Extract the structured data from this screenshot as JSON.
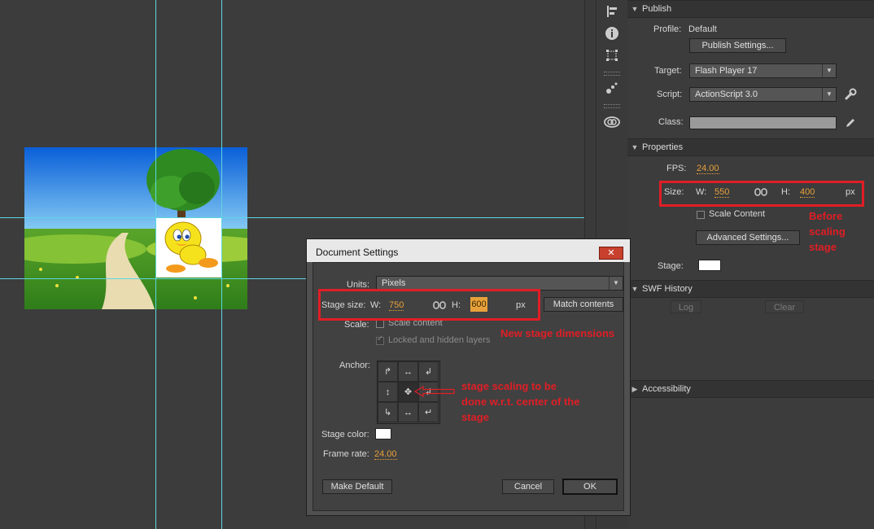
{
  "publish": {
    "header": "Publish",
    "profile_label": "Profile:",
    "profile_value": "Default",
    "publish_settings_button": "Publish Settings...",
    "target_label": "Target:",
    "target_value": "Flash Player 17",
    "script_label": "Script:",
    "script_value": "ActionScript 3.0",
    "class_label": "Class:"
  },
  "properties": {
    "header": "Properties",
    "fps_label": "FPS:",
    "fps_value": "24.00",
    "size_label": "Size:",
    "w_label": "W:",
    "w_value": "550",
    "h_label": "H:",
    "h_value": "400",
    "unit": "px",
    "scale_content_label": "Scale Content",
    "advanced_settings_button": "Advanced Settings...",
    "stage_label": "Stage:",
    "stage_color": "#ffffff"
  },
  "swf_history": {
    "header": "SWF History",
    "log_button": "Log",
    "clear_button": "Clear"
  },
  "accessibility": {
    "header": "Accessibility"
  },
  "dialog": {
    "title": "Document Settings",
    "close_label": "✕",
    "units_label": "Units:",
    "units_value": "Pixels",
    "stage_size_label": "Stage size:",
    "w_label": "W:",
    "w_value": "750",
    "h_label": "H:",
    "h_value": "600",
    "unit": "px",
    "match_contents_button": "Match contents",
    "scale_label": "Scale:",
    "scale_content_label": "Scale content",
    "locked_hidden_label": "Locked and hidden layers",
    "anchor_label": "Anchor:",
    "anchor_cells": [
      "↱",
      "↔",
      "↲",
      "↕",
      "✥",
      "↲",
      "↳",
      "↔",
      "↵"
    ],
    "stage_color_label": "Stage color:",
    "frame_rate_label": "Frame rate:",
    "frame_rate_value": "24.00",
    "make_default_button": "Make Default",
    "cancel_button": "Cancel",
    "ok_button": "OK"
  },
  "annotations": {
    "before_scaling": "Before scaling stage",
    "new_dimensions": "New stage dimensions",
    "center_note": "stage scaling to be done w.r.t. center of the stage"
  },
  "colors": {
    "annotation_red": "#e01e26",
    "value_orange": "#e8a13a",
    "guide_cyan": "#5fd6e0"
  }
}
